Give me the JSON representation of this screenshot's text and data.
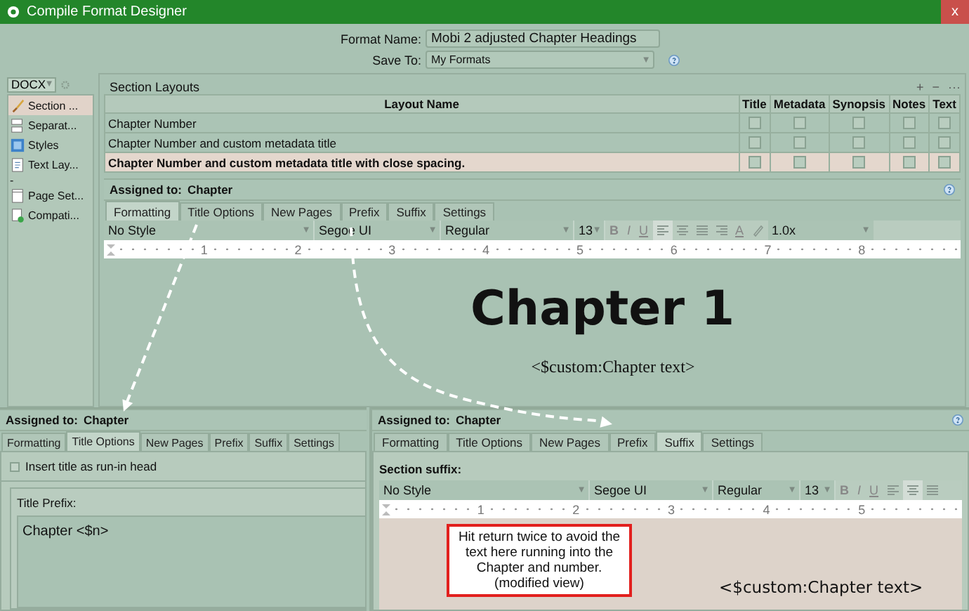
{
  "window": {
    "title": "Compile Format Designer",
    "close_label": "x"
  },
  "header": {
    "format_name_label": "Format Name:",
    "format_name_value": "Mobi 2 adjusted Chapter Headings",
    "save_to_label": "Save To:",
    "save_to_value": "My Formats",
    "save_to_caret": "▼"
  },
  "sidebar": {
    "format": "DOCX",
    "format_caret": "▼",
    "items": [
      {
        "label": "Section ...",
        "selected": true
      },
      {
        "label": "Separat...",
        "selected": false
      },
      {
        "label": "Styles",
        "selected": false
      },
      {
        "label": "Text Lay...",
        "selected": false
      },
      {
        "label": "-",
        "selected": false
      },
      {
        "label": "Page Set...",
        "selected": false
      },
      {
        "label": "Compati...",
        "selected": false
      }
    ]
  },
  "section_layouts": {
    "title": "Section Layouts",
    "add": "+",
    "remove": "−",
    "more": "···",
    "columns": [
      "Layout Name",
      "Title",
      "Metadata",
      "Synopsis",
      "Notes",
      "Text"
    ],
    "rows": [
      {
        "name": "Chapter Number",
        "selected": false,
        "title": false,
        "metadata": false,
        "synopsis": false,
        "notes": false,
        "text": false
      },
      {
        "name": "Chapter Number and custom metadata title",
        "selected": false,
        "title": false,
        "metadata": false,
        "synopsis": false,
        "notes": false,
        "text": false
      },
      {
        "name": "Chapter Number and custom metadata title with close spacing.",
        "selected": true,
        "title": false,
        "metadata": false,
        "synopsis": false,
        "notes": false,
        "text": false
      }
    ]
  },
  "main_editor": {
    "assigned_label": "Assigned to:",
    "assigned_value": "Chapter",
    "tabs": [
      {
        "label": "Formatting",
        "selected": true
      },
      {
        "label": "Title Options",
        "selected": false
      },
      {
        "label": "New Pages",
        "selected": false
      },
      {
        "label": "Prefix",
        "selected": false
      },
      {
        "label": "Suffix",
        "selected": false
      },
      {
        "label": "Settings",
        "selected": false
      }
    ],
    "toolbar": {
      "style": "No Style",
      "font": "Segoe UI",
      "weight": "Regular",
      "size": "13",
      "bold": "B",
      "italic": "I",
      "underline": "U",
      "align_buttons": [
        {
          "selected": true
        },
        {
          "selected": false
        },
        {
          "selected": false
        },
        {
          "selected": false
        }
      ],
      "text_color": "A",
      "spacing": "1.0x",
      "carets": [
        "▼",
        "▼",
        "▼",
        "▼",
        "▼"
      ]
    },
    "ruler": [
      "1",
      "2",
      "3",
      "4",
      "5",
      "6",
      "7",
      "8"
    ],
    "heading": "Chapter 1",
    "body": "<$custom:Chapter text>"
  },
  "title_options_panel": {
    "assigned_label": "Assigned to:",
    "assigned_value": "Chapter",
    "tabs": [
      {
        "label": "Formatting",
        "selected": false
      },
      {
        "label": "Title Options",
        "selected": true
      },
      {
        "label": "New Pages",
        "selected": false
      },
      {
        "label": "Prefix",
        "selected": false
      },
      {
        "label": "Suffix",
        "selected": false
      },
      {
        "label": "Settings",
        "selected": false
      }
    ],
    "run_in_head": {
      "label": "Insert title as run-in head",
      "checked": false
    },
    "prefix_label": "Title Prefix:",
    "prefix_value": "Chapter <$n>"
  },
  "suffix_panel": {
    "assigned_label": "Assigned to:",
    "assigned_value": "Chapter",
    "tabs": [
      {
        "label": "Formatting",
        "selected": false
      },
      {
        "label": "Title Options",
        "selected": false
      },
      {
        "label": "New Pages",
        "selected": false
      },
      {
        "label": "Prefix",
        "selected": false
      },
      {
        "label": "Suffix",
        "selected": true
      },
      {
        "label": "Settings",
        "selected": false
      }
    ],
    "section_label": "Section suffix:",
    "toolbar": {
      "style": "No Style",
      "font": "Segoe UI",
      "weight": "Regular",
      "size": "13",
      "bold": "B",
      "italic": "I",
      "underline": "U",
      "align_buttons": [
        {
          "selected": false
        },
        {
          "selected": true
        },
        {
          "selected": false
        }
      ],
      "carets": [
        "▼",
        "▼",
        "▼",
        "▼"
      ]
    },
    "ruler": [
      "1",
      "2",
      "3",
      "4",
      "5"
    ],
    "note": "Hit return twice to avoid the text here running into the Chapter and number. (modified view)",
    "body": "<$custom:Chapter text>"
  }
}
